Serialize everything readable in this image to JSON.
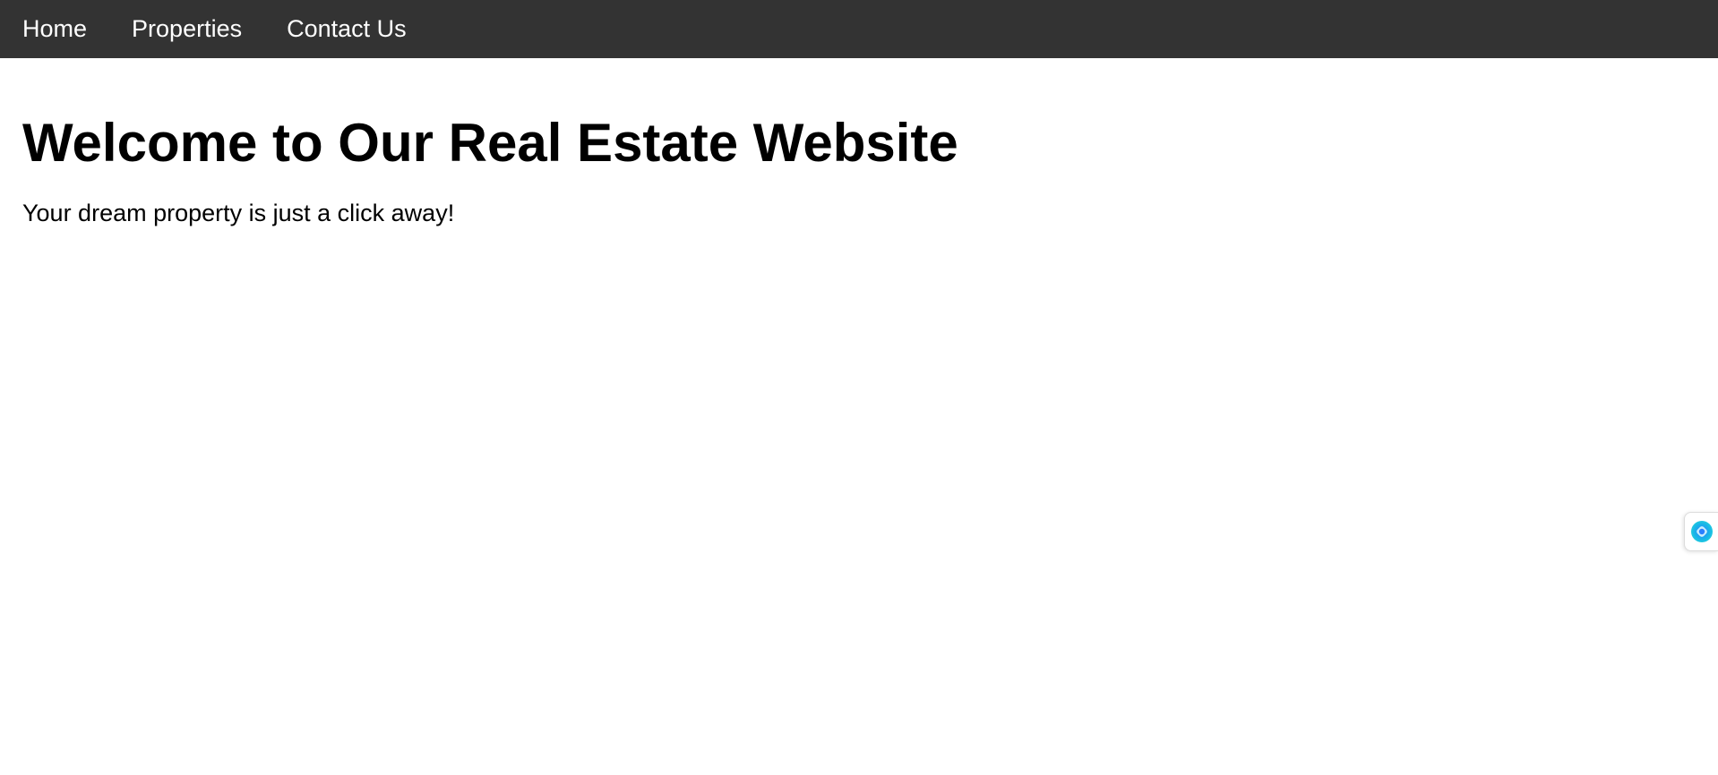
{
  "nav": {
    "items": [
      {
        "label": "Home"
      },
      {
        "label": "Properties"
      },
      {
        "label": "Contact Us"
      }
    ]
  },
  "main": {
    "title": "Welcome to Our Real Estate Website",
    "tagline": "Your dream property is just a click away!"
  },
  "widget": {
    "icon": "assistant-orb-icon",
    "colors": {
      "outer": "#1ec8e0",
      "inner": "#2a7fff",
      "highlight": "#e9fbff"
    }
  },
  "colors": {
    "navbar_bg": "#333333",
    "nav_text": "#ffffff",
    "page_bg": "#ffffff",
    "body_text": "#000000"
  }
}
